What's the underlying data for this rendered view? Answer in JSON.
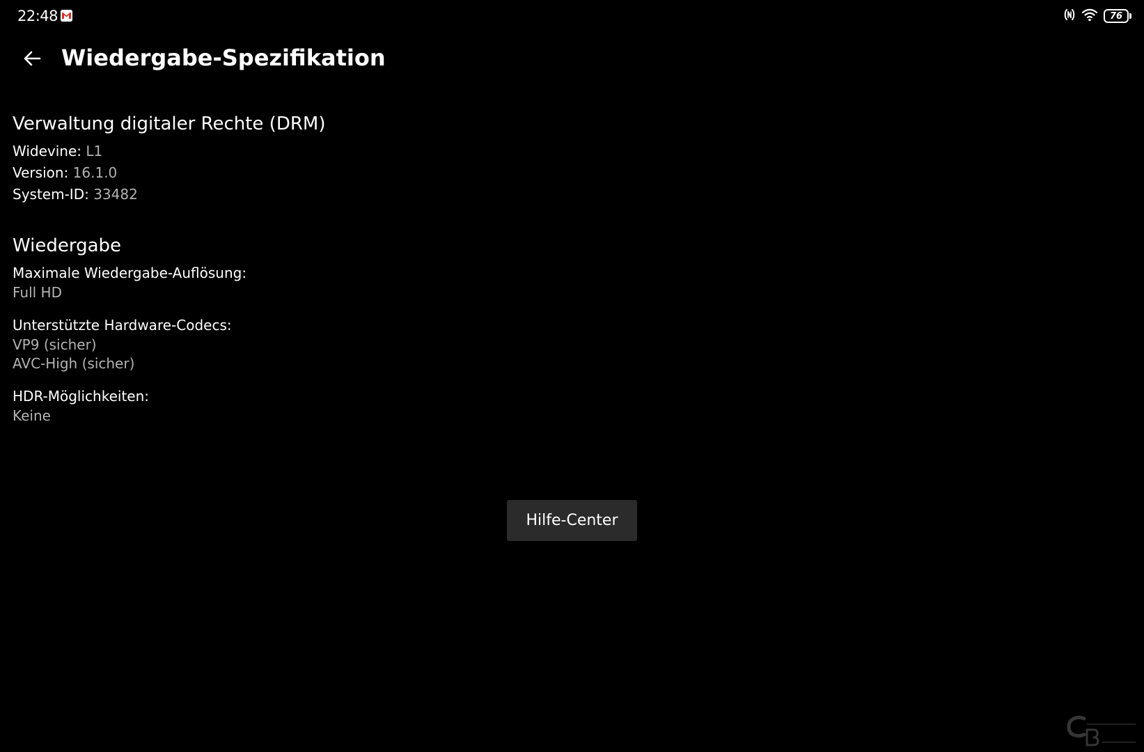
{
  "status_bar": {
    "time": "22:48",
    "battery_level": "76",
    "icons": [
      "gmail-icon",
      "nfc-icon",
      "wifi-icon",
      "battery-icon"
    ]
  },
  "header": {
    "title": "Wiedergabe-Spezifikation",
    "back_icon": "arrow-left-icon"
  },
  "drm": {
    "title": "Verwaltung digitaler Rechte (DRM)",
    "items": [
      {
        "label": "Widevine:",
        "value": "L1"
      },
      {
        "label": "Version:",
        "value": "16.1.0"
      },
      {
        "label": "System-ID:",
        "value": "33482"
      }
    ]
  },
  "playback": {
    "title": "Wiedergabe",
    "max_resolution": {
      "label": "Maximale Wiedergabe-Auflösung:",
      "value": "Full HD"
    },
    "codecs": {
      "label": "Unterstützte Hardware-Codecs:",
      "values": [
        "VP9 (sicher)",
        "AVC-High (sicher)"
      ]
    },
    "hdr": {
      "label": "HDR-Möglichkeiten:",
      "value": "Keine"
    }
  },
  "help_button": {
    "label": "Hilfe-Center"
  },
  "watermark": {
    "logo": "computerbase-logo"
  },
  "colors": {
    "background": "#000000",
    "text_primary": "#ffffff",
    "text_secondary": "#b3b3b3",
    "button_bg": "#2b2b2b"
  }
}
